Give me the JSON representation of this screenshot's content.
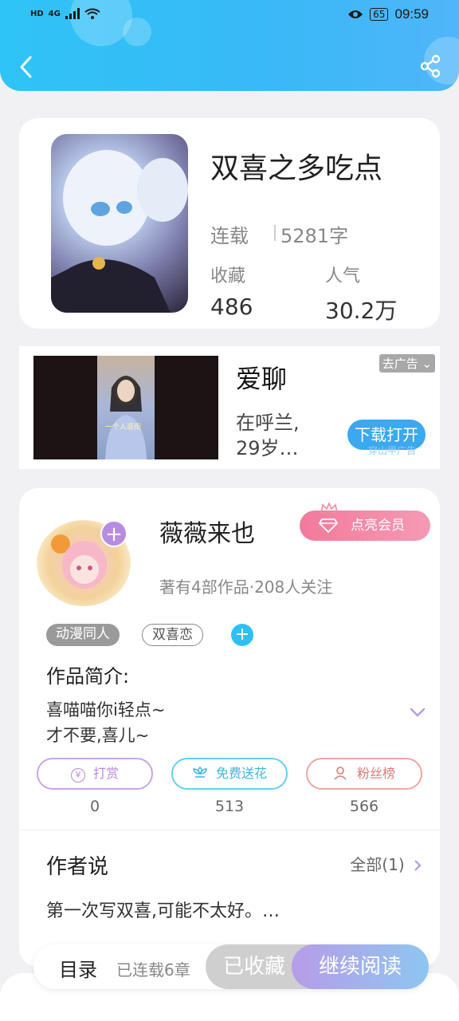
{
  "status_bar": {
    "left_labels": [
      "HD",
      "4G"
    ],
    "battery": "65",
    "time": "09:59"
  },
  "book": {
    "title": "双喜之多吃点",
    "status": "连载",
    "word_count": "5281字",
    "favorites_label": "收藏",
    "favorites_value": "486",
    "popularity_label": "人气",
    "popularity_value": "30.2万"
  },
  "ad": {
    "title": "爱聊",
    "desc_line1": "在呼兰,",
    "desc_line2": "29岁…",
    "tag": "去广告",
    "button": "下载打开",
    "caption": "一个人逛街",
    "fade": "穿山甲广告"
  },
  "author": {
    "name": "薇薇来也",
    "vip_button": "点亮会员",
    "meta": "著有4部作品·208人关注",
    "tags": [
      "动漫同人",
      "双喜恋"
    ],
    "intro_title": "作品简介:",
    "intro_line1": "喜喵喵你i轻点~",
    "intro_line2": "才不要,喜儿~",
    "actions": [
      {
        "label": "打赏",
        "count": "0"
      },
      {
        "label": "免费送花",
        "count": "513"
      },
      {
        "label": "粉丝榜",
        "count": "566"
      }
    ],
    "say_title": "作者说",
    "say_all": "全部(1)",
    "say_text": "第一次写双喜,可能不太好。…"
  },
  "bottom": {
    "toc": "目录",
    "toc_sub": "已连载6章",
    "collected": "已收藏",
    "continue": "继续阅读"
  }
}
